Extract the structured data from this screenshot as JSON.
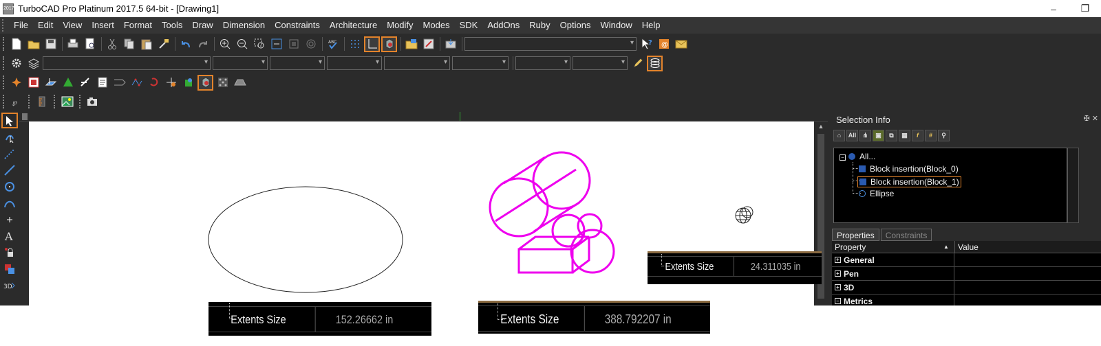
{
  "window": {
    "title": "TurboCAD Pro Platinum 2017.5 64-bit - [Drawing1]",
    "app_icon_text": "2017",
    "minimize": "–",
    "restore": "❐"
  },
  "menu": [
    "File",
    "Edit",
    "View",
    "Insert",
    "Format",
    "Tools",
    "Draw",
    "Dimension",
    "Constraints",
    "Architecture",
    "Modify",
    "Modes",
    "SDK",
    "AddOns",
    "Ruby",
    "Options",
    "Window",
    "Help"
  ],
  "selection_info": {
    "title": "Selection Info",
    "pin": "✠ ✕",
    "toolbar": [
      "all-icon",
      "All",
      "filter-icon",
      "select-icon",
      "copy-icon",
      "table-icon",
      "f",
      "grid-icon",
      "search-icon"
    ],
    "tree": {
      "root": "All...",
      "items": [
        "Block insertion(Block_0)",
        "Block insertion(Block_1)",
        "Ellipse"
      ],
      "selected_index": 1
    }
  },
  "properties": {
    "tabs": [
      "Properties",
      "Constraints"
    ],
    "active_tab": "Properties",
    "col_property": "Property",
    "col_value": "Value",
    "sort_indicator": "▲",
    "groups": [
      "General",
      "Pen",
      "3D",
      "Metrics"
    ]
  },
  "extents_snippets": [
    {
      "label": "Extents Size",
      "value": "24.311035 in"
    },
    {
      "label": "Extents Size",
      "value": "152.26662 in"
    },
    {
      "label": "Extents Size",
      "value": "388.792207 in"
    }
  ],
  "left_tools": [
    "select-arrow",
    "edit-tool",
    "construction-line",
    "line",
    "circle",
    "arc",
    "point",
    "text",
    "snap",
    "layers",
    "3d-view"
  ],
  "colors": {
    "magenta": "#ee00ee",
    "accent": "#e3832b",
    "panel_bg": "#2b2b2b",
    "menu_bg": "#353535"
  }
}
